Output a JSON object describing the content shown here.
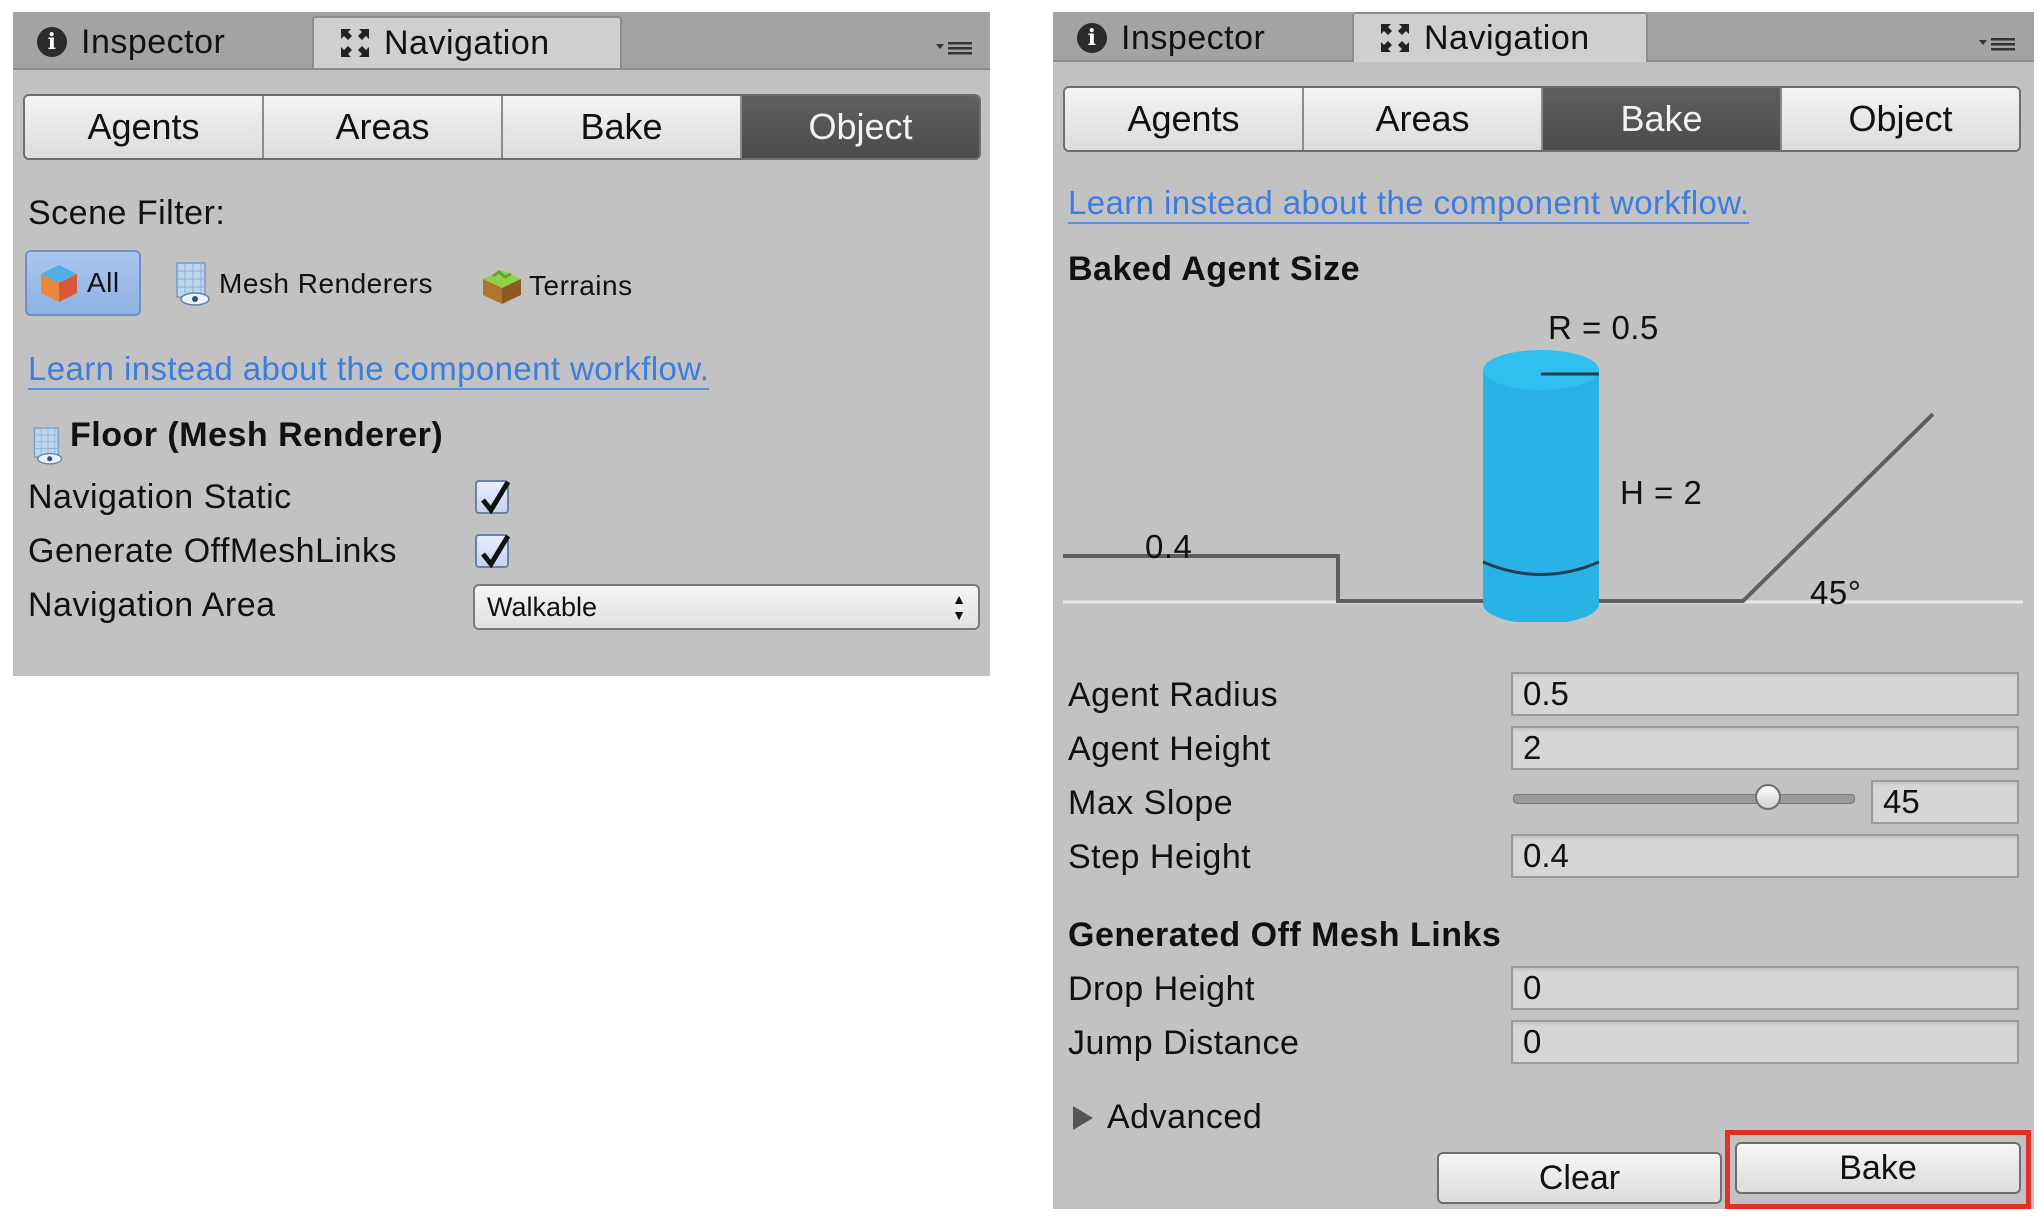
{
  "left_panel": {
    "window_tabs": {
      "inspector": "Inspector",
      "navigation": "Navigation"
    },
    "segments": [
      "Agents",
      "Areas",
      "Bake",
      "Object"
    ],
    "selected_segment": "Object",
    "scene_filter_label": "Scene Filter:",
    "filters": {
      "all": "All",
      "mesh_renderers": "Mesh Renderers",
      "terrains": "Terrains"
    },
    "learn_link": "Learn instead about the component workflow.",
    "object_title": "Floor (Mesh Renderer)",
    "navigation_static_label": "Navigation Static",
    "navigation_static": true,
    "generate_offmeshlinks_label": "Generate OffMeshLinks",
    "generate_offmeshlinks": true,
    "navigation_area_label": "Navigation Area",
    "navigation_area_value": "Walkable"
  },
  "right_panel": {
    "window_tabs": {
      "inspector": "Inspector",
      "navigation": "Navigation"
    },
    "segments": [
      "Agents",
      "Areas",
      "Bake",
      "Object"
    ],
    "selected_segment": "Bake",
    "learn_link": "Learn instead about the component workflow.",
    "baked_agent_size_title": "Baked Agent Size",
    "diagram": {
      "radius_label": "R = 0.5",
      "height_label": "H = 2",
      "step_label": "0.4",
      "slope_label": "45°"
    },
    "agent_radius_label": "Agent Radius",
    "agent_radius": "0.5",
    "agent_height_label": "Agent Height",
    "agent_height": "2",
    "max_slope_label": "Max Slope",
    "max_slope": "45",
    "max_slope_fraction": 0.75,
    "step_height_label": "Step Height",
    "step_height": "0.4",
    "offmesh_title": "Generated Off Mesh Links",
    "drop_height_label": "Drop Height",
    "drop_height": "0",
    "jump_distance_label": "Jump Distance",
    "jump_distance": "0",
    "advanced_label": "Advanced",
    "clear_button": "Clear",
    "bake_button": "Bake"
  },
  "colors": {
    "panel_bg": "#c2c2c2",
    "link_blue": "#3b7de0",
    "agent_cylinder": "#29b2e6",
    "highlight_red": "#e0302a"
  }
}
